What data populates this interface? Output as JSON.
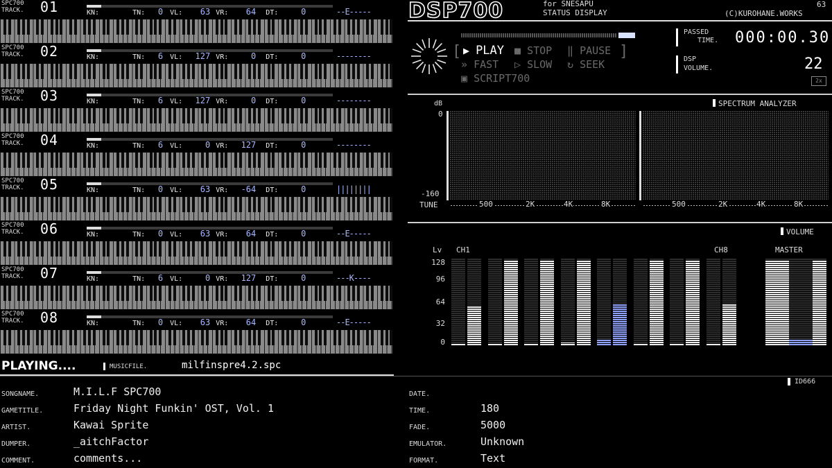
{
  "tracks": [
    {
      "label_top": "SPC700",
      "label_bottom": "TRACK.",
      "number": "01",
      "kn": "KN:",
      "tn_label": "TN:",
      "tn": "0",
      "vl_label": "VL:",
      "vl": "63",
      "vr_label": "VR:",
      "vr": "64",
      "dt_label": "DT:",
      "dt": "0",
      "env": "--E-----",
      "level": 0.06
    },
    {
      "label_top": "SPC700",
      "label_bottom": "TRACK.",
      "number": "02",
      "kn": "KN:",
      "tn_label": "TN:",
      "tn": "6",
      "vl_label": "VL:",
      "vl": "127",
      "vr_label": "VR:",
      "vr": "0",
      "dt_label": "DT:",
      "dt": "0",
      "env": "--------",
      "level": 0.06
    },
    {
      "label_top": "SPC700",
      "label_bottom": "TRACK.",
      "number": "03",
      "kn": "KN:",
      "tn_label": "TN:",
      "tn": "6",
      "vl_label": "VL:",
      "vl": "127",
      "vr_label": "VR:",
      "vr": "0",
      "dt_label": "DT:",
      "dt": "0",
      "env": "--------",
      "level": 0.06
    },
    {
      "label_top": "SPC700",
      "label_bottom": "TRACK.",
      "number": "04",
      "kn": "KN:",
      "tn_label": "TN:",
      "tn": "6",
      "vl_label": "VL:",
      "vl": "0",
      "vr_label": "VR:",
      "vr": "127",
      "dt_label": "DT:",
      "dt": "0",
      "env": "--------",
      "level": 0.06
    },
    {
      "label_top": "SPC700",
      "label_bottom": "TRACK.",
      "number": "05",
      "kn": "KN:",
      "tn_label": "TN:",
      "tn": "0",
      "vl_label": "VL:",
      "vl": "63",
      "vr_label": "VR:",
      "vr": "-64",
      "dt_label": "DT:",
      "dt": "0",
      "env": "||||||||",
      "level": 0.06
    },
    {
      "label_top": "SPC700",
      "label_bottom": "TRACK.",
      "number": "06",
      "kn": "KN:",
      "tn_label": "TN:",
      "tn": "0",
      "vl_label": "VL:",
      "vl": "63",
      "vr_label": "VR:",
      "vr": "64",
      "dt_label": "DT:",
      "dt": "0",
      "env": "--E-----",
      "level": 0.06
    },
    {
      "label_top": "SPC700",
      "label_bottom": "TRACK.",
      "number": "07",
      "kn": "KN:",
      "tn_label": "TN:",
      "tn": "6",
      "vl_label": "VL:",
      "vl": "0",
      "vr_label": "VR:",
      "vr": "127",
      "dt_label": "DT:",
      "dt": "0",
      "env": "---K----",
      "level": 0.06
    },
    {
      "label_top": "SPC700",
      "label_bottom": "TRACK.",
      "number": "08",
      "kn": "KN:",
      "tn_label": "TN:",
      "tn": "0",
      "vl_label": "VL:",
      "vl": "63",
      "vr_label": "VR:",
      "vr": "64",
      "dt_label": "DT:",
      "dt": "0",
      "env": "--E-----",
      "level": 0.06
    }
  ],
  "status": {
    "playing": "PLAYING....",
    "musicfile_label": "MUSICFILE.",
    "musicfile": "milfinspre4.2.spc"
  },
  "header": {
    "logo": "DSP700",
    "sub1": "for SNESAPU",
    "sub2": "STATUS DISPLAY",
    "copyright": "(C)KUROHANE.WORKS",
    "top_number": "63"
  },
  "transport": {
    "play": "PLAY",
    "stop": "STOP",
    "pause": "PAUSE",
    "fast": "FAST",
    "slow": "SLOW",
    "seek": "SEEK",
    "script": "SCRIPT700",
    "passed_label_1": "PASSED",
    "passed_label_2": "TIME.",
    "time": "000:00.30",
    "dsp_label_1": "DSP",
    "dsp_label_2": "VOLUME.",
    "volume": "22",
    "vol_badge": "2x"
  },
  "spectrum": {
    "title": "SPECTRUM ANALYZER",
    "db_label": "dB",
    "top_tick": "0",
    "bottom_tick": "-160",
    "tune_label": "TUNE",
    "x_ticks": [
      "500",
      "2K",
      "4K",
      "8K"
    ]
  },
  "volume_meter": {
    "title": "VOLUME",
    "lv_label": "Lv",
    "ch_first": "CH1",
    "ch_last": "CH8",
    "master": "MASTER",
    "ticks": [
      "128",
      "96",
      "64",
      "32",
      "0"
    ],
    "channels": [
      {
        "l": 0.03,
        "r": 0.45,
        "color": "white"
      },
      {
        "l": 0.03,
        "r": 0.98,
        "color": "white"
      },
      {
        "l": 0.03,
        "r": 0.98,
        "color": "white"
      },
      {
        "l": 0.04,
        "r": 0.98,
        "color": "white"
      },
      {
        "l": 0.08,
        "r": 0.47,
        "color": "blue"
      },
      {
        "l": 0.03,
        "r": 0.98,
        "color": "white"
      },
      {
        "l": 0.03,
        "r": 0.98,
        "color": "white"
      },
      {
        "l": 0.03,
        "r": 0.47,
        "color": "white"
      }
    ],
    "master_levels": [
      0.98,
      0.98,
      0.08,
      0.08,
      0.98
    ]
  },
  "info": {
    "id_label": "ID666",
    "songname_label": "SONGNAME.",
    "songname": "M.I.L.F SPC700",
    "gametitle_label": "GAMETITLE.",
    "gametitle": "Friday Night Funkin' OST, Vol. 1",
    "artist_label": "ARTIST.",
    "artist": "Kawai Sprite",
    "dumper_label": "DUMPER.",
    "dumper": "_aitchFactor",
    "comment_label": "COMMENT.",
    "comment": "comments...",
    "date_label": "DATE.",
    "date": "",
    "time_label": "TIME.",
    "time": "180",
    "fade_label": "FADE.",
    "fade": "5000",
    "emulator_label": "EMULATOR.",
    "emulator": "Unknown",
    "format_label": "FORMAT.",
    "format": "Text"
  }
}
